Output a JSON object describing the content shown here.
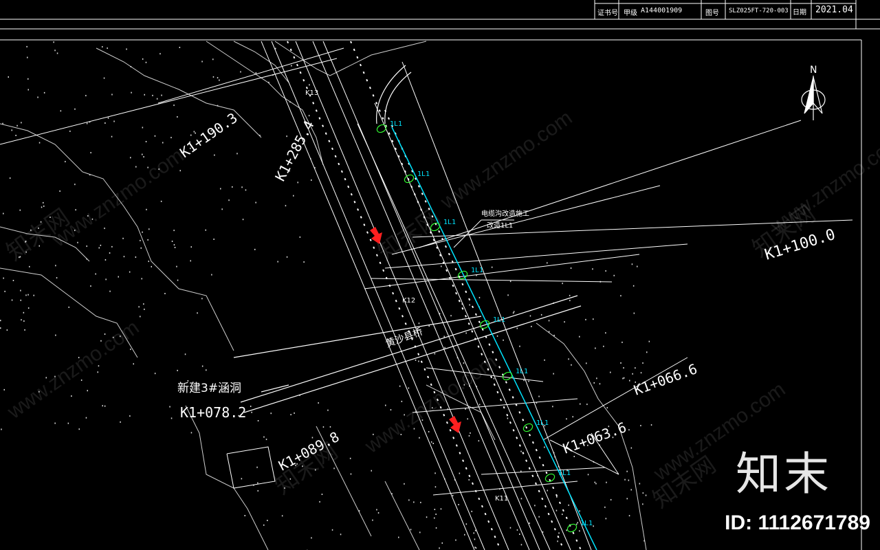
{
  "title_block": {
    "cert_label": "证书号",
    "cert_grade": "甲级",
    "cert_no": "A144001909",
    "drawing_no_label": "图号",
    "drawing_no": "SLZ025FT-720-003",
    "date_label": "日期",
    "date": "2021.04"
  },
  "stations": {
    "k1_190_3": "K1+190.3",
    "k1_285_4": "K1+285.4",
    "k1_100_0": "K1+100.0",
    "k1_078_2": "K1+078.2",
    "k1_089_8": "K1+089.8",
    "k1_066_6": "K1+066.6",
    "k1_063_6": "K1+063.6"
  },
  "structures": {
    "bridge": "黄沙县桥",
    "culvert": "新建3#涵洞",
    "cable_note_1": "电缆沟改造施工",
    "cable_note_2": "改造1L1"
  },
  "markers": {
    "route": "1L1",
    "north": "N",
    "k12": "K12",
    "k11": "K11",
    "k13": "K13"
  },
  "branding": {
    "logo": "知末",
    "id": "ID: 1112671789",
    "watermark": "www.znzmo.com",
    "watermark_cn": "知末网"
  },
  "colors": {
    "background": "#000000",
    "route_line": "#00e5ff",
    "marker": "#33ff33",
    "arrow": "#ff2020",
    "linework": "#ffffff"
  }
}
